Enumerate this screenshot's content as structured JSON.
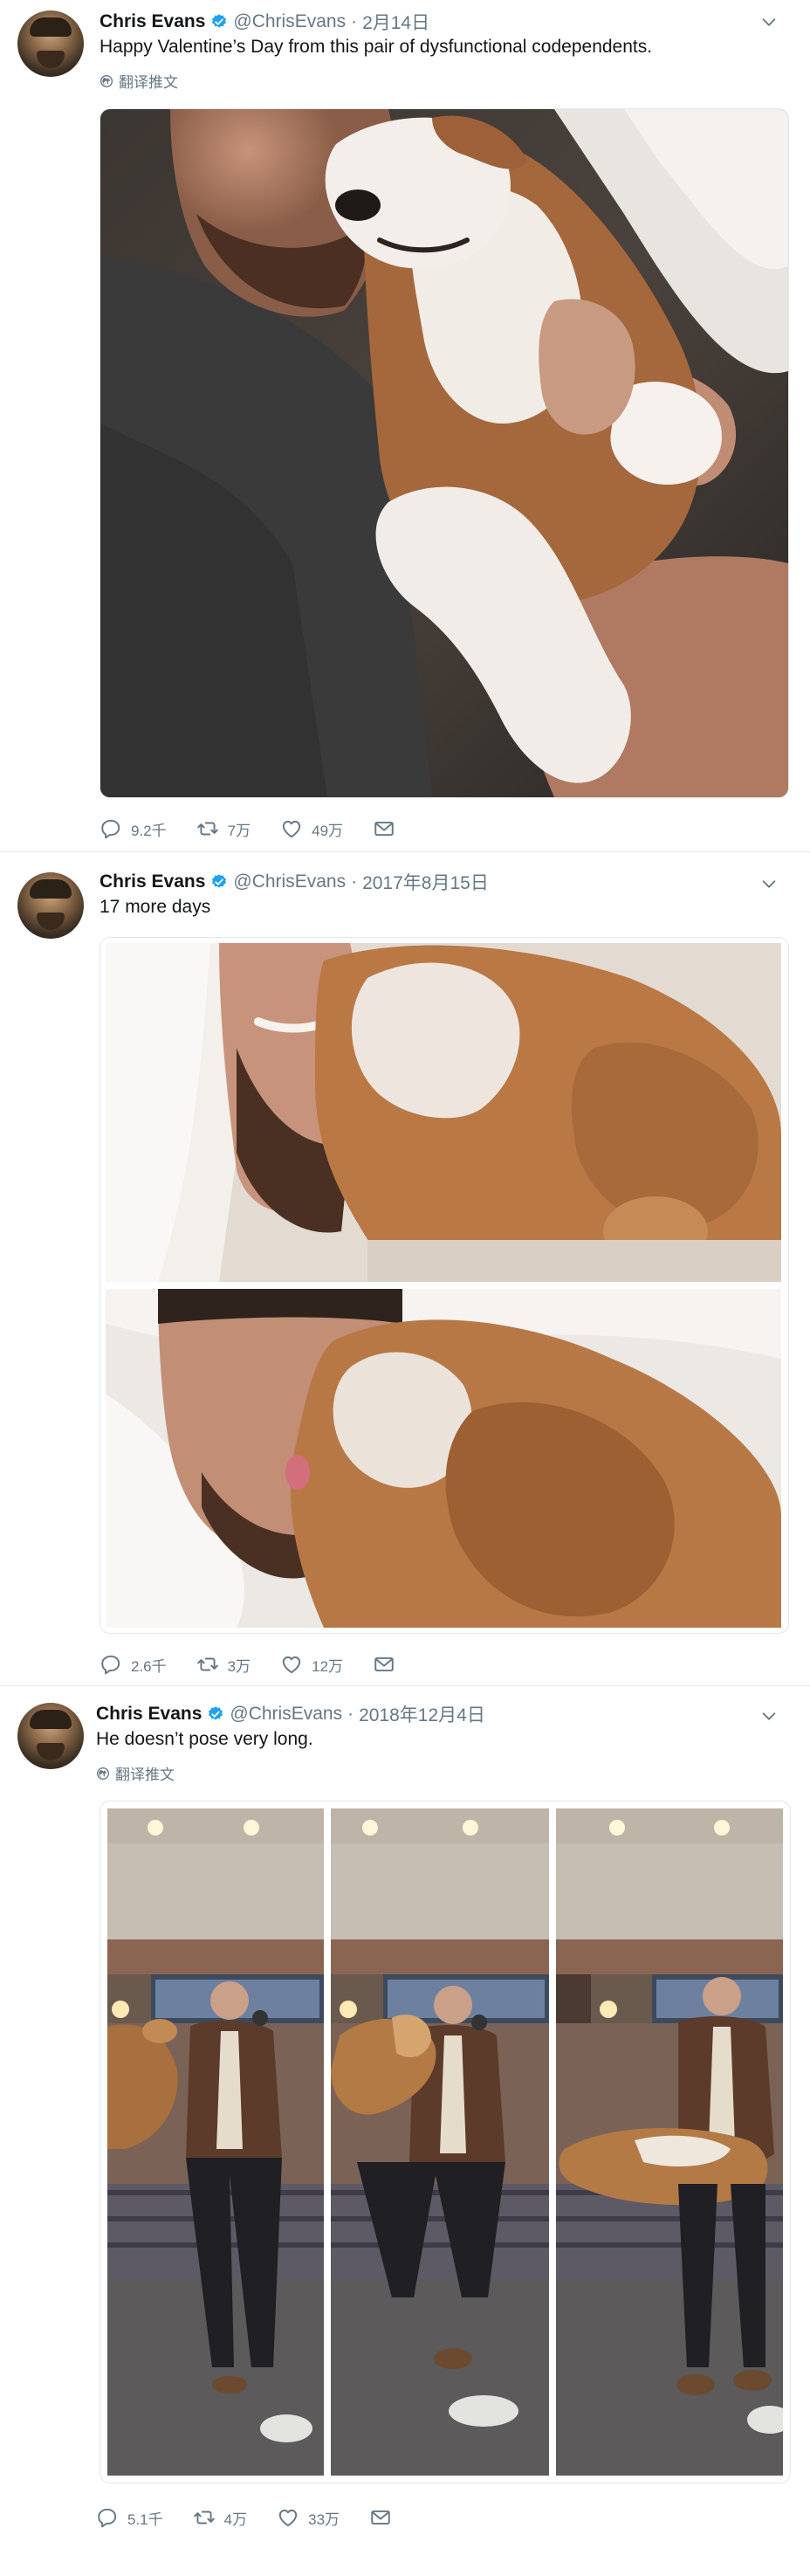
{
  "tweets": [
    {
      "name": "Chris Evans",
      "handle": "@ChrisEvans",
      "date": "2月14日",
      "text": "Happy Valentine’s Day from this pair of dysfunctional codependents.",
      "translate": "翻译推文",
      "reply_count": "9.2千",
      "retweet_count": "7万",
      "like_count": "49万"
    },
    {
      "name": "Chris Evans",
      "handle": "@ChrisEvans",
      "date": "2017年8月15日",
      "text": "17 more days",
      "reply_count": "2.6千",
      "retweet_count": "3万",
      "like_count": "12万"
    },
    {
      "name": "Chris Evans",
      "handle": "@ChrisEvans",
      "date": "2018年12月4日",
      "text": "He doesn’t pose very long.",
      "translate": "翻译推文",
      "reply_count": "5.1千",
      "retweet_count": "4万",
      "like_count": "33万"
    }
  ],
  "icons": {
    "verified": "verified-badge-icon",
    "caret": "chevron-down-icon",
    "globe": "globe-icon",
    "reply": "reply-icon",
    "retweet": "retweet-icon",
    "like": "heart-icon",
    "message": "envelope-icon"
  },
  "colors": {
    "accent": "#1da1f2",
    "secondary_text": "#657786",
    "primary_text": "#14171a",
    "divider": "#e6ecf0"
  }
}
